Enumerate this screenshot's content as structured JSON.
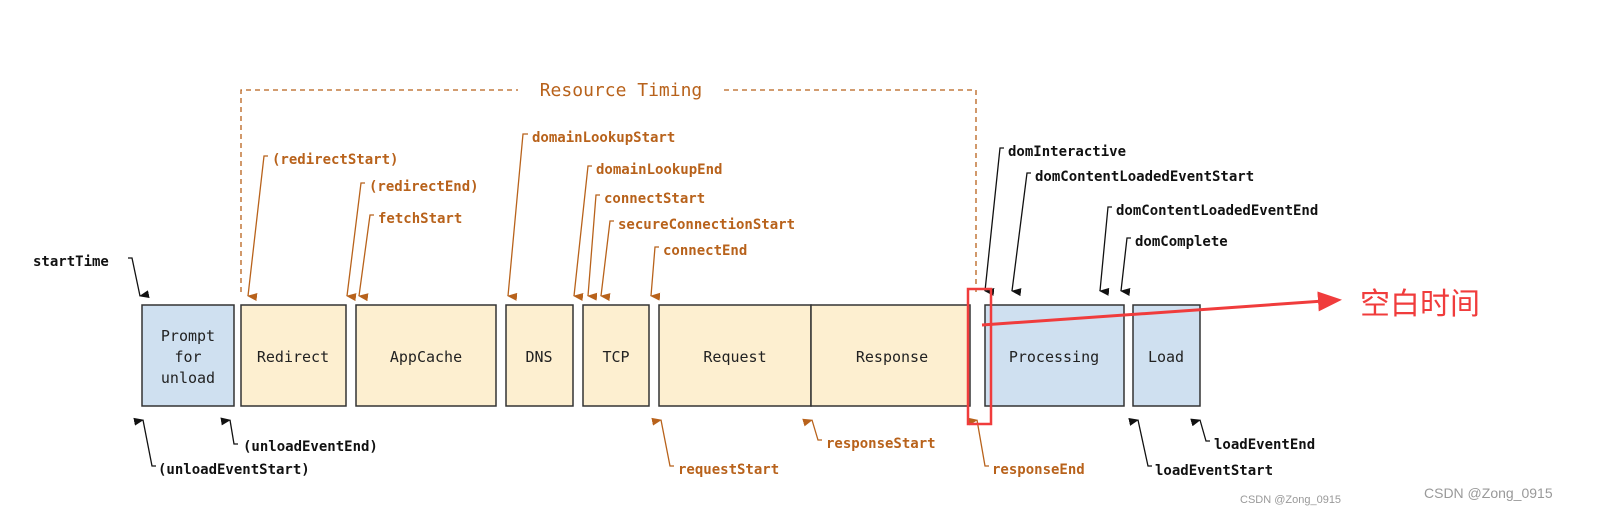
{
  "title": "Resource Timing",
  "colors": {
    "network_box": "#fdefd0",
    "browser_box": "#cfe0f0",
    "orange": "#b8621b",
    "annotation_red": "#f03c3c"
  },
  "boxes": {
    "prompt": [
      "Prompt",
      "for",
      "unload"
    ],
    "redirect": "Redirect",
    "appcache": "AppCache",
    "dns": "DNS",
    "tcp": "TCP",
    "request": "Request",
    "response": "Response",
    "processing": "Processing",
    "load": "Load"
  },
  "top_labels": {
    "startTime": "startTime",
    "redirectStart": "(redirectStart)",
    "redirectEnd": "(redirectEnd)",
    "fetchStart": "fetchStart",
    "domainLookupStart": "domainLookupStart",
    "domainLookupEnd": "domainLookupEnd",
    "connectStart": "connectStart",
    "secureConnectionStart": "secureConnectionStart",
    "connectEnd": "connectEnd",
    "domInteractive": "domInteractive",
    "domContentLoadedEventStart": "domContentLoadedEventStart",
    "domContentLoadedEventEnd": "domContentLoadedEventEnd",
    "domComplete": "domComplete"
  },
  "bottom_labels": {
    "unloadEventStart": "(unloadEventStart)",
    "unloadEventEnd": "(unloadEventEnd)",
    "requestStart": "requestStart",
    "responseStart": "responseStart",
    "responseEnd": "responseEnd",
    "loadEventStart": "loadEventStart",
    "loadEventEnd": "loadEventEnd"
  },
  "annotation": "空白时间",
  "watermarks": [
    "CSDN @Zong_0915",
    "CSDN @Zong_0915"
  ]
}
